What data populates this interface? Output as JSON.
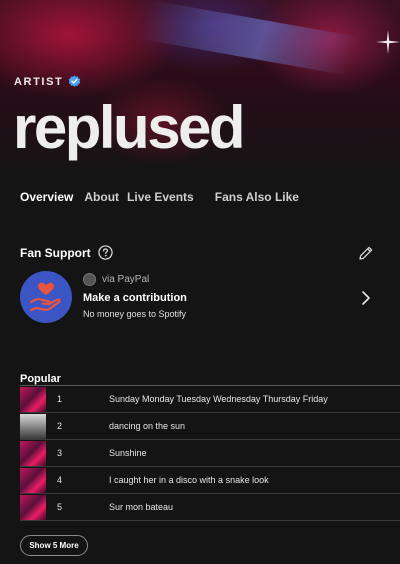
{
  "header": {
    "artist_label": "ARTIST",
    "artist_name": "replused",
    "verified_color": "#4ca3f5"
  },
  "tabs": [
    {
      "label": "Overview",
      "active": true
    },
    {
      "label": "About",
      "active": false
    },
    {
      "label": "Live Events",
      "active": false
    },
    {
      "label": "Fans Also Like",
      "active": false
    }
  ],
  "fan_support": {
    "title": "Fan Support",
    "provider": "via PayPal",
    "contribution_title": "Make a contribution",
    "contribution_subtitle": "No money goes to Spotify",
    "accent_color": "#3c55c4",
    "icon_color": "#e8553f"
  },
  "popular": {
    "title": "Popular",
    "tracks": [
      {
        "number": "1",
        "title": "Sunday Monday Tuesday Wednesday Thursday Friday"
      },
      {
        "number": "2",
        "title": "dancing on the sun"
      },
      {
        "number": "3",
        "title": "Sunshine"
      },
      {
        "number": "4",
        "title": "I caught her in a disco with a snake look"
      },
      {
        "number": "5",
        "title": "Sur mon bateau"
      }
    ],
    "show_more_label": "Show 5 More"
  }
}
